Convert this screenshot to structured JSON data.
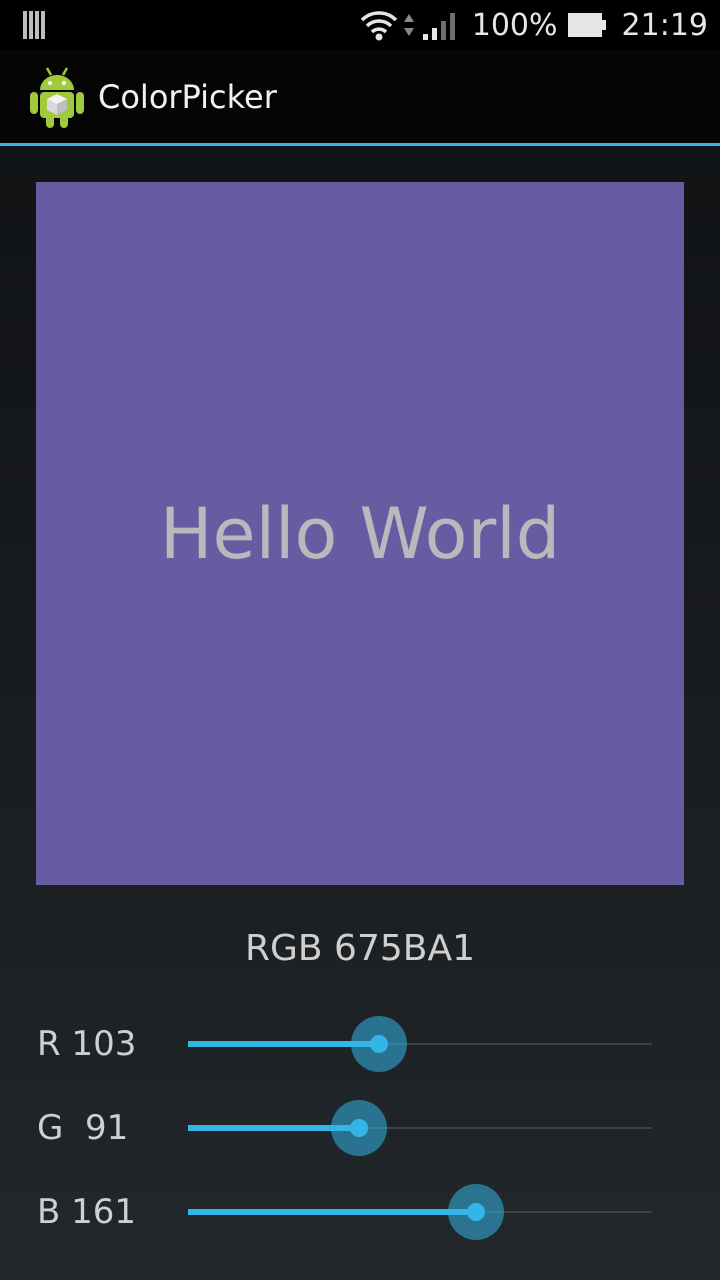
{
  "status_bar": {
    "battery_percent": "100%",
    "time": "21:19"
  },
  "app": {
    "title": "ColorPicker",
    "icon": "android-icon"
  },
  "preview": {
    "text": "Hello World",
    "background_color": "#675BA1"
  },
  "rgb_label": "RGB 675BA1",
  "sliders": [
    {
      "label": "R 103",
      "value": 103,
      "max": 255,
      "color": "#33b5e5"
    },
    {
      "label": "G  91",
      "value": 91,
      "max": 255,
      "color": "#33b5e5"
    },
    {
      "label": "B 161",
      "value": 161,
      "max": 255,
      "color": "#33b5e5"
    }
  ]
}
